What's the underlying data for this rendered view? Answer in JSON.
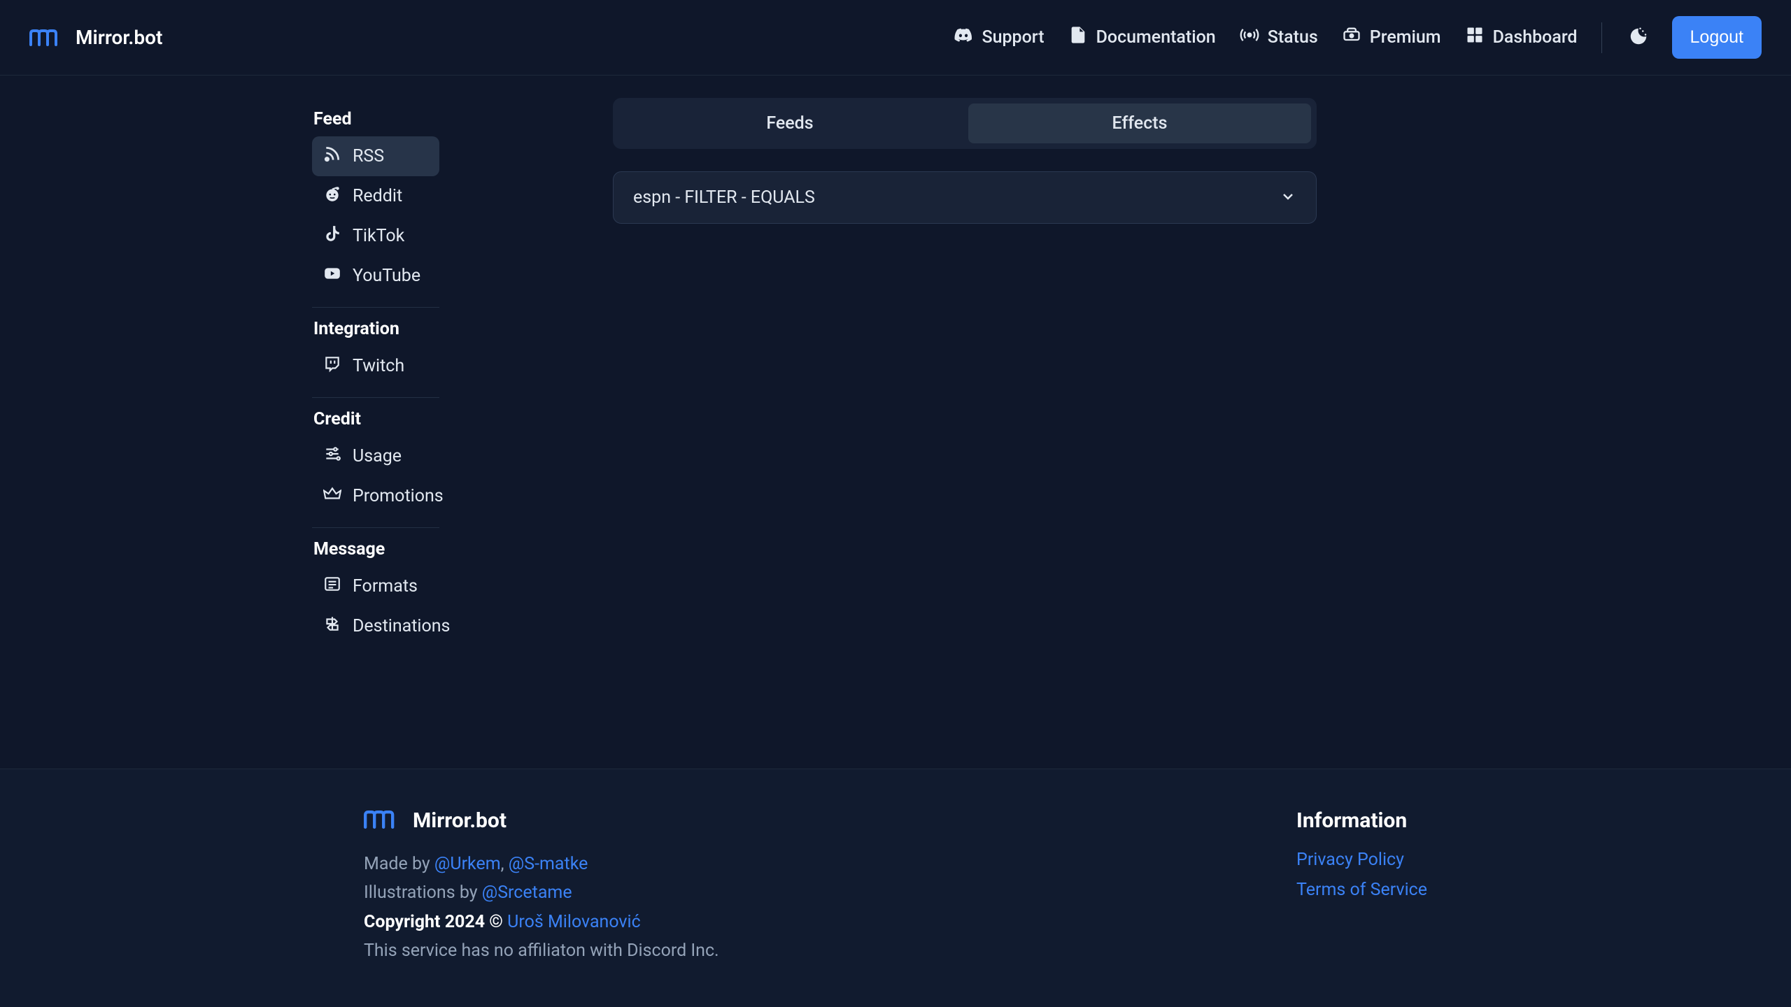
{
  "brand": "Mirror.bot",
  "nav": {
    "support": "Support",
    "documentation": "Documentation",
    "status": "Status",
    "premium": "Premium",
    "dashboard": "Dashboard",
    "logout": "Logout"
  },
  "sidebar": {
    "sections": [
      {
        "heading": "Feed",
        "items": [
          {
            "icon": "rss",
            "label": "RSS",
            "active": true
          },
          {
            "icon": "reddit",
            "label": "Reddit"
          },
          {
            "icon": "tiktok",
            "label": "TikTok"
          },
          {
            "icon": "youtube",
            "label": "YouTube"
          }
        ]
      },
      {
        "heading": "Integration",
        "items": [
          {
            "icon": "twitch",
            "label": "Twitch"
          }
        ]
      },
      {
        "heading": "Credit",
        "items": [
          {
            "icon": "sliders",
            "label": "Usage"
          },
          {
            "icon": "crown",
            "label": "Promotions"
          }
        ]
      },
      {
        "heading": "Message",
        "items": [
          {
            "icon": "list",
            "label": "Formats"
          },
          {
            "icon": "signpost",
            "label": "Destinations"
          }
        ]
      }
    ]
  },
  "tabs": {
    "feeds": "Feeds",
    "effects": "Effects",
    "active": "effects"
  },
  "dropdown": {
    "selected": "espn - FILTER - EQUALS"
  },
  "footer": {
    "made_by_prefix": "Made by ",
    "made_by_1": "@Urkem",
    "made_by_sep": ", ",
    "made_by_2": "@S-matke",
    "illustrations_prefix": "Illustrations by ",
    "illustrations_by": "@Srcetame",
    "copyright_prefix": "Copyright 2024 © ",
    "copyright_name": "Uroš Milovanović",
    "disclaimer": "This service has no affiliaton with Discord Inc.",
    "info_heading": "Information",
    "privacy": "Privacy Policy",
    "terms": "Terms of Service"
  }
}
